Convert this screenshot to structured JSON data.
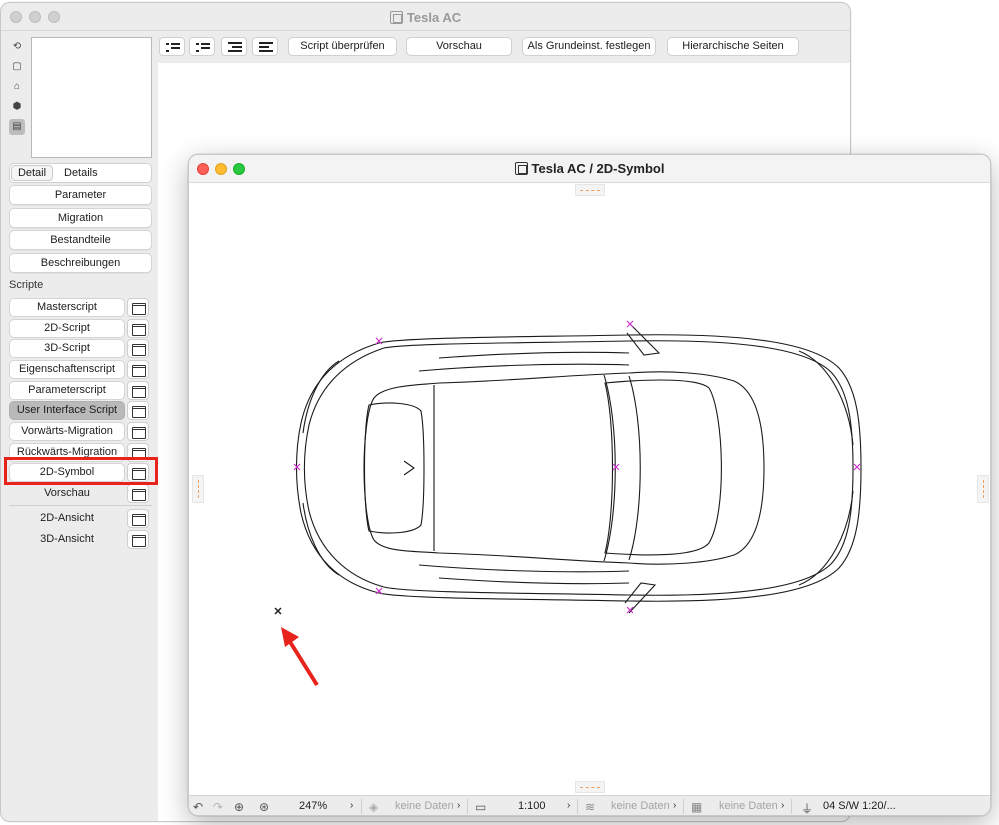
{
  "back_window": {
    "title": "Tesla AC",
    "detail_tabs": [
      "Detail",
      "Details"
    ],
    "nav_buttons": [
      "Parameter",
      "Migration",
      "Bestandteile",
      "Beschreibungen"
    ],
    "section_label": "Scripte",
    "scripts": [
      {
        "label": "Masterscript"
      },
      {
        "label": "2D-Script"
      },
      {
        "label": "3D-Script"
      },
      {
        "label": "Eigenschaftenscript"
      },
      {
        "label": "Parameterscript"
      },
      {
        "label": "User Interface Script"
      },
      {
        "label": "Vorwärts-Migration"
      },
      {
        "label": "Rückwärts-Migration"
      },
      {
        "label": "2D-Symbol"
      },
      {
        "label": "Vorschau"
      }
    ],
    "views": [
      {
        "label": "2D-Ansicht"
      },
      {
        "label": "3D-Ansicht"
      }
    ],
    "toolbar": {
      "check_script": "Script überprüfen",
      "preview": "Vorschau",
      "set_default": "Als Grundeinst. festlegen",
      "hierarchical_pages": "Hierarchische Seiten"
    }
  },
  "front_window": {
    "title": "Tesla AC / 2D-Symbol",
    "status": {
      "zoom": "247%",
      "layer_combo": "keine Daten",
      "scale": "1:100",
      "layers": "keine Daten",
      "structure": "keine Daten",
      "pen_set": "04 S/W 1:20/..."
    }
  },
  "colors": {
    "highlight": "#e8231b",
    "arrow": "#e8231b",
    "hotspot": "#cc33cc"
  }
}
